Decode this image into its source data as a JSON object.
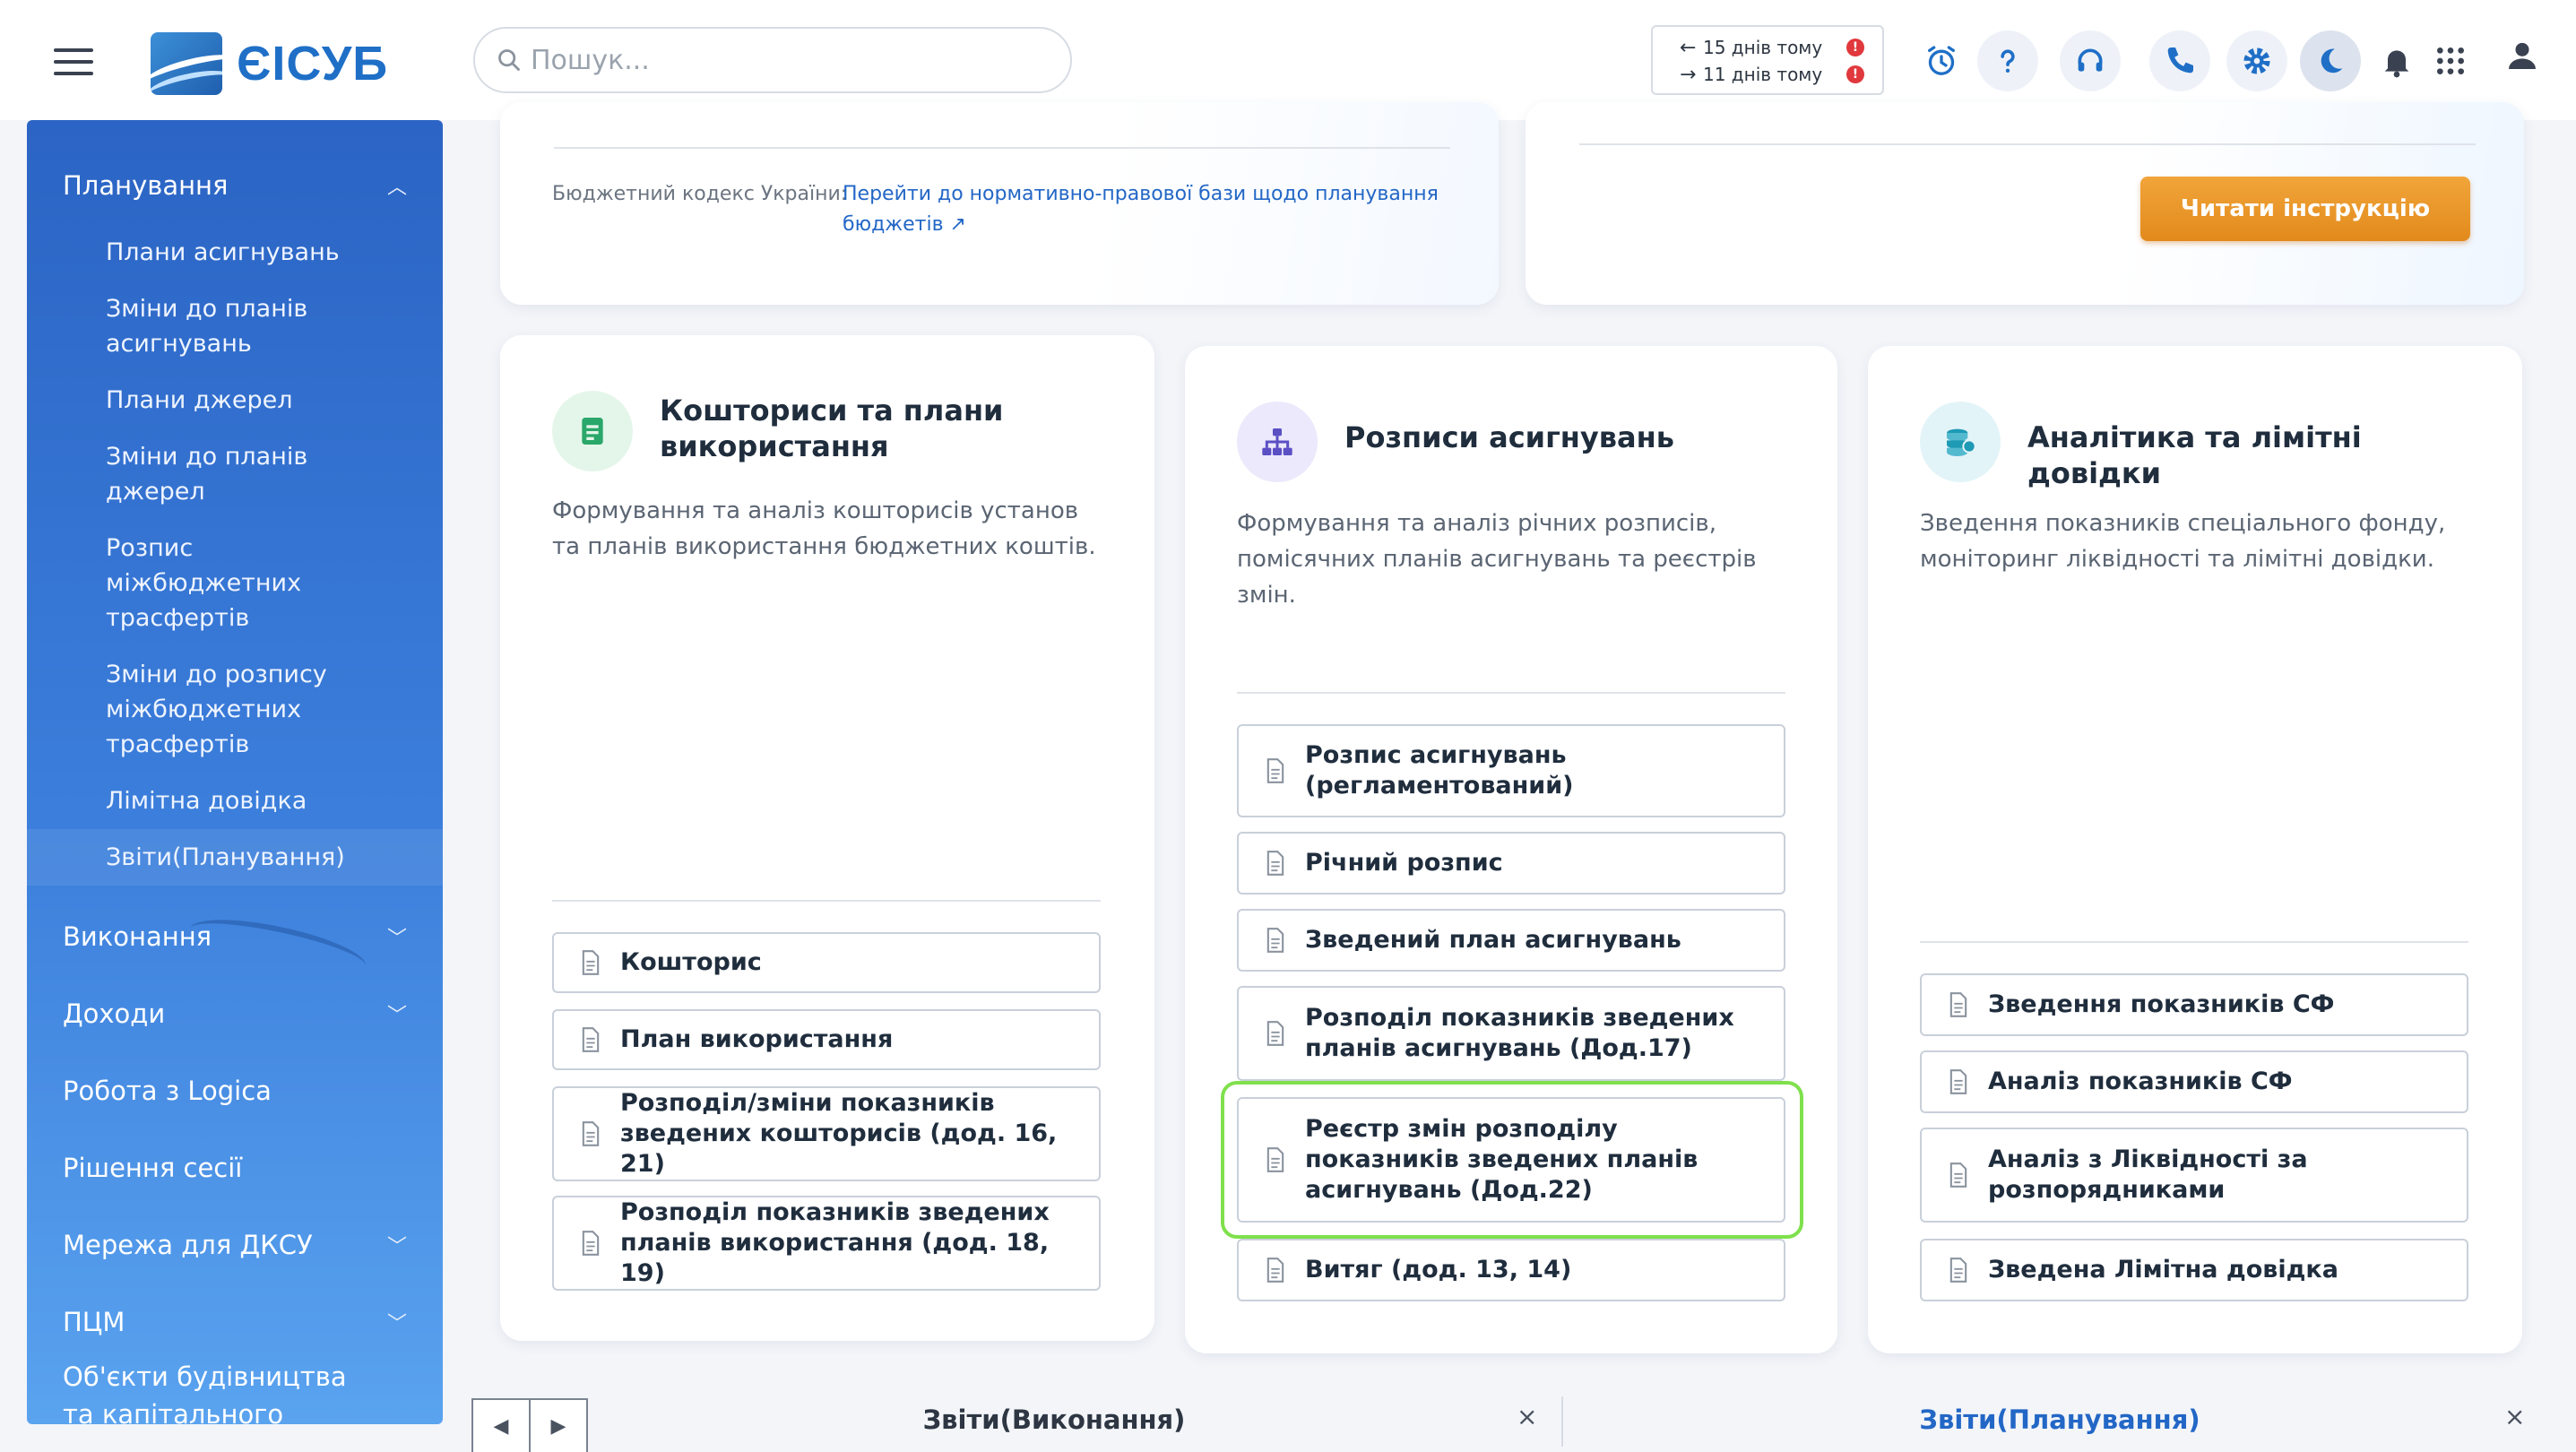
{
  "app": {
    "logo_text": "ЄІСУБ"
  },
  "search": {
    "placeholder": "Пошук..."
  },
  "days": {
    "prev": "15 днів тому",
    "next": "11 днів тому",
    "alert_mark": "!"
  },
  "sidebar": {
    "groups": [
      {
        "label": "Планування",
        "expanded": true,
        "items": [
          "Плани асигнувань",
          "Зміни до планів асигнувань",
          "Плани джерел",
          "Зміни до планів джерел",
          "Розпис міжбюджетних трасфертів",
          "Зміни до розпису міжбюджетних трасфертів",
          "Лімітна довідка",
          "Звіти(Планування)"
        ]
      },
      {
        "label": "Виконання"
      },
      {
        "label": "Доходи"
      },
      {
        "label": "Робота з Logica"
      },
      {
        "label": "Рішення сесії"
      },
      {
        "label": "Мережа для ДКСУ"
      },
      {
        "label": "ПЦМ"
      },
      {
        "label": "Об'єкти будівництва та капітального ремонту"
      }
    ]
  },
  "top_info": {
    "budget_label": "Бюджетний кодекс України:",
    "budget_link": "Перейти до нормативно-правової бази щодо планування бюджетів",
    "read_button": "Читати інструкцію"
  },
  "cards": [
    {
      "title": "Кошториси та плани використання",
      "desc": "Формування та аналіз кошторисів установ та планів використання бюджетних коштів.",
      "buttons": [
        "Кошторис",
        "План використання",
        "Розподіл/зміни показників зведених кошторисів (дод. 16, 21)",
        "Розподіл показників зведених планів використання (дод. 18, 19)"
      ]
    },
    {
      "title": "Розписи асигнувань",
      "desc": "Формування та аналіз річних розписів, помісячних планів асигнувань та реєстрів змін.",
      "buttons": [
        "Розпис асигнувань (регламентований)",
        "Річний розпис",
        "Зведений план асигнувань",
        "Розподіл показників зведених планів асигнувань (Дод.17)",
        "Реєстр змін розподілу показників зведених планів асигнувань (Дод.22)",
        "Витяг (дод. 13, 14)"
      ]
    },
    {
      "title": "Аналітика та лімітні довідки",
      "desc": "Зведення показників спеціального фонду, моніторинг ліквідності та лімітні довідки.",
      "buttons": [
        "Зведення показників СФ",
        "Аналіз показників СФ",
        "Аналіз з Ліквідності за розпорядниками",
        "Зведена Лімітна довідка"
      ]
    }
  ],
  "tabs": [
    {
      "label": "Звіти(Виконання)",
      "active": false
    },
    {
      "label": "Звіти(Планування)",
      "active": true
    }
  ],
  "icons": {
    "menu": "hamburger-icon",
    "search": "search-icon",
    "alarm": "alarm-clock-icon",
    "help": "question-icon",
    "support": "headset-icon",
    "phone": "phone-icon",
    "settings": "gear-icon",
    "theme": "moon-icon",
    "notifications": "bell-icon",
    "apps": "grid-icon",
    "user": "user-icon"
  },
  "colors": {
    "accent": "#2367c6",
    "orange": "#e8951f",
    "highlight": "#7fe04c",
    "sidebar": "#3575d3"
  }
}
